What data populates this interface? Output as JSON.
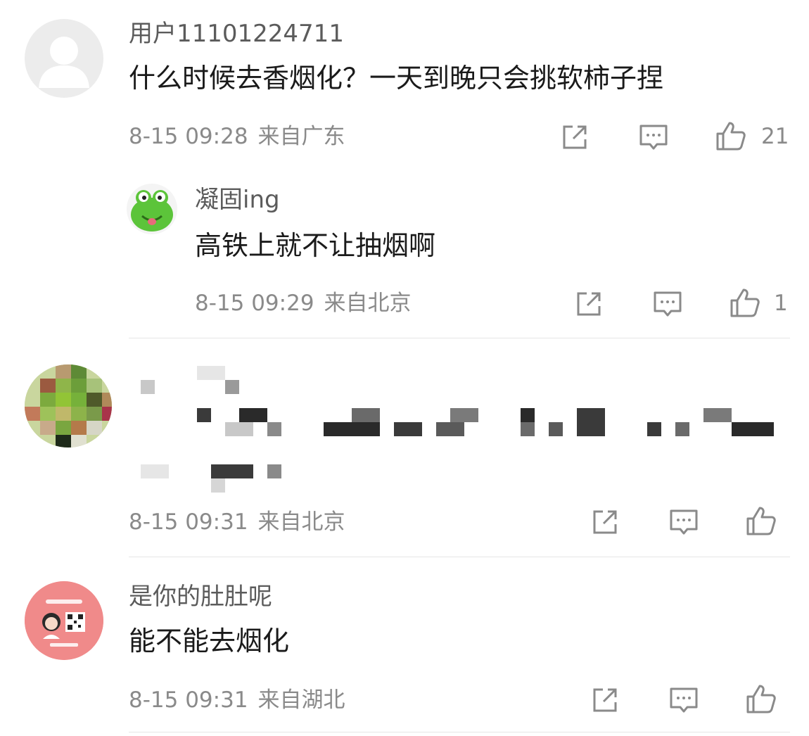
{
  "comments": [
    {
      "username": "用户11101224711",
      "text": "什么时候去香烟化？一天到晚只会挑软柿子捏",
      "date": "8-15 09:28",
      "location": "来自广东",
      "likes": "21",
      "avatar_icon": "default-user-avatar"
    },
    {
      "username": "凝固ing",
      "text": "高铁上就不让抽烟啊",
      "date": "8-15 09:29",
      "location": "来自北京",
      "likes": "1",
      "avatar_icon": "green-frog-avatar"
    },
    {
      "username": "",
      "text": "",
      "date": "8-15 09:31",
      "location": "来自北京",
      "likes": "",
      "avatar_icon": "pixelated-avatar"
    },
    {
      "username": "是你的肚肚呢",
      "text": "能不能去烟化",
      "date": "8-15 09:31",
      "location": "来自湖北",
      "likes": "",
      "avatar_icon": "pink-sticker-avatar"
    }
  ],
  "colors": {
    "meta_gray": "#8a8a8a",
    "name_gray": "#5b5b5b",
    "divider": "#e6e6e6",
    "pink_avatar": "#f08a8a",
    "frog_green": "#5cc43a"
  }
}
